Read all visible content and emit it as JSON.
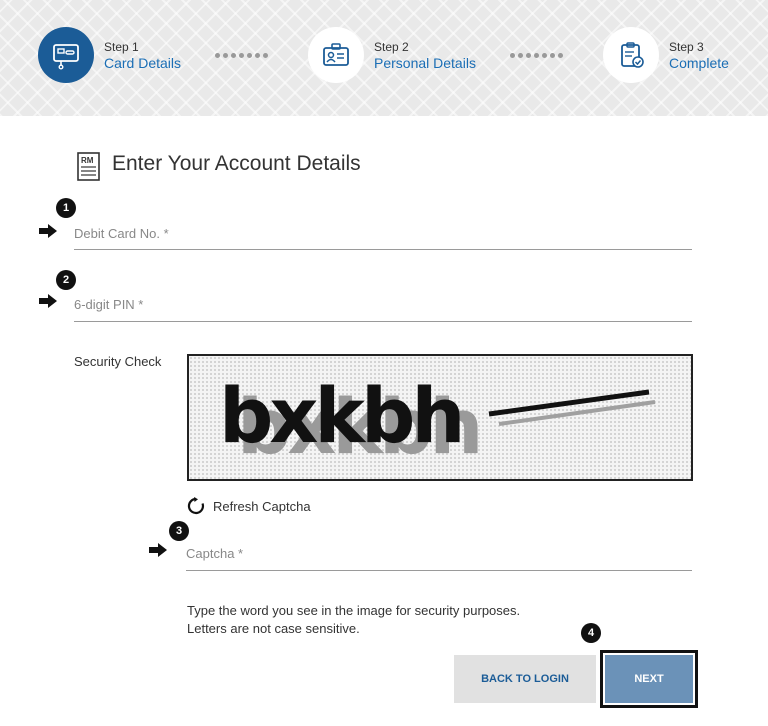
{
  "steps": [
    {
      "num": "Step 1",
      "name": "Card Details",
      "icon": "card-icon",
      "active": true
    },
    {
      "num": "Step 2",
      "name": "Personal Details",
      "icon": "id-badge-icon",
      "active": false
    },
    {
      "num": "Step 3",
      "name": "Complete",
      "icon": "clipboard-check-icon",
      "active": false
    }
  ],
  "form": {
    "title": "Enter Your Account Details",
    "debit_card_placeholder": "Debit Card No. *",
    "pin_placeholder": "6-digit PIN *",
    "security_label": "Security Check",
    "captcha_text": "bxkbh",
    "refresh_label": "Refresh Captcha",
    "captcha_placeholder": "Captcha *",
    "instruction_line1": "Type the word you see in the image for security purposes.",
    "instruction_line2": "Letters are not case sensitive."
  },
  "annotations": [
    "1",
    "2",
    "3",
    "4"
  ],
  "buttons": {
    "back": "BACK TO LOGIN",
    "next": "NEXT"
  },
  "colors": {
    "primary": "#1b5c97",
    "link": "#1b6eb5",
    "next_button": "#6b92b8",
    "back_button": "#e1e1e1"
  }
}
